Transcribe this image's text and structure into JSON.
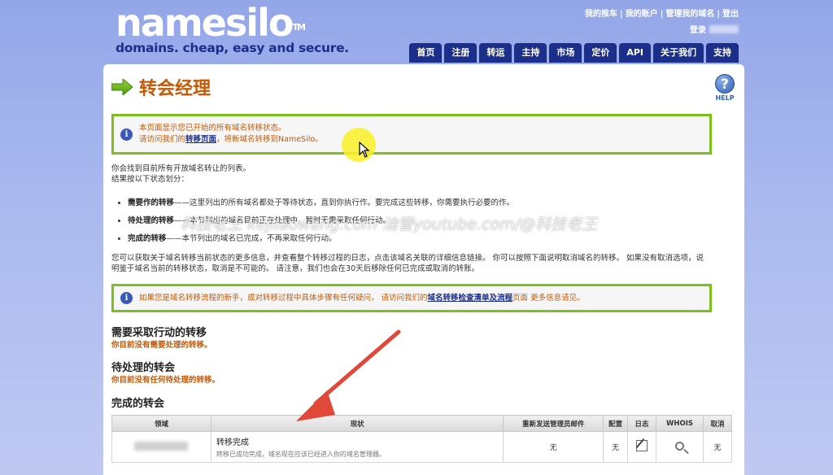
{
  "header": {
    "logo_main": "namesilo",
    "logo_tm": "TM",
    "logo_tagline": "domains. cheap, easy and secure.",
    "toplinks": [
      "我的推车",
      "我的账户",
      "管理我的域名",
      "登出"
    ],
    "login_label": "登录",
    "nav": [
      "首页",
      "注册",
      "转运",
      "主持",
      "市场",
      "定价",
      "API",
      "关于我们",
      "支持"
    ]
  },
  "page": {
    "title": "转会经理",
    "help_label": "HELP",
    "notice1_line1": "本页面显示您已开始的所有域名转移状态。",
    "notice1_line2_pre": "请访问我们的",
    "notice1_link": "转移页面",
    "notice1_line2_post": "，将新域名转移到NameSilo。",
    "intro_line1": "你会找到目前所有开放域名转让的列表。",
    "intro_line2": "结果按以下状态划分：",
    "bullets": [
      {
        "term": "需要作的转移",
        "desc": "——这里列出的所有域名都处于等待状态，直到你执行作。要完成这些转移，你需要执行必要的作。"
      },
      {
        "term": "待处理的转移",
        "desc": "——本节列出的域名目前正在处理中，暂时无需采取任何行动。"
      },
      {
        "term": "完成的转移",
        "desc": "——本节列出的域名已完成，不再采取任何行动。"
      }
    ],
    "para_line1": "您可以获取关于域名转移当前状态的更多信息，并查看整个转移过程的日志，点击该域名关联的详细信息链接。 你可以按照下面说明取消域名的转移。 如果没有取消选项，说",
    "para_line2": "明鉴于域名当前的转移状态，取消是不可能的。 请注意，我们也会在30天后移除任何已完成或取消的转账。",
    "notice2_pre": "如果您是域名转移流程的新手，或对转移过程中具体步骤有任何疑问， 请访问我们的",
    "notice2_link": "域名转移检查清单及流程",
    "notice2_post": "页面 更多信息请见。"
  },
  "sections": {
    "action_title": "需要采取行动的转移",
    "action_empty": "你目前没有需要处理的转移。",
    "pending_title": "待处理的转会",
    "pending_empty": "你目前没有任何待处理的转移。",
    "completed_title": "完成的转会"
  },
  "table": {
    "headers": [
      "领域",
      "现状",
      "重新发送管理员邮件",
      "配置",
      "日志",
      "WHOIS",
      "取消"
    ],
    "row": {
      "status_title": "转移完成",
      "status_desc": "转移已成功完成，域名现在应该已经进入你的域名管理器。",
      "resend": "无",
      "config": "无",
      "cancel": "无"
    }
  },
  "overlay": {
    "watermark": "科技老王 kejilaowang.com 油管youtube.com/@科技老王"
  },
  "colors": {
    "accent_orange": "#c45a07",
    "nav_blue": "#1b2f8a",
    "notice_border": "#7bc11e",
    "arrow_red": "#e0483a"
  }
}
